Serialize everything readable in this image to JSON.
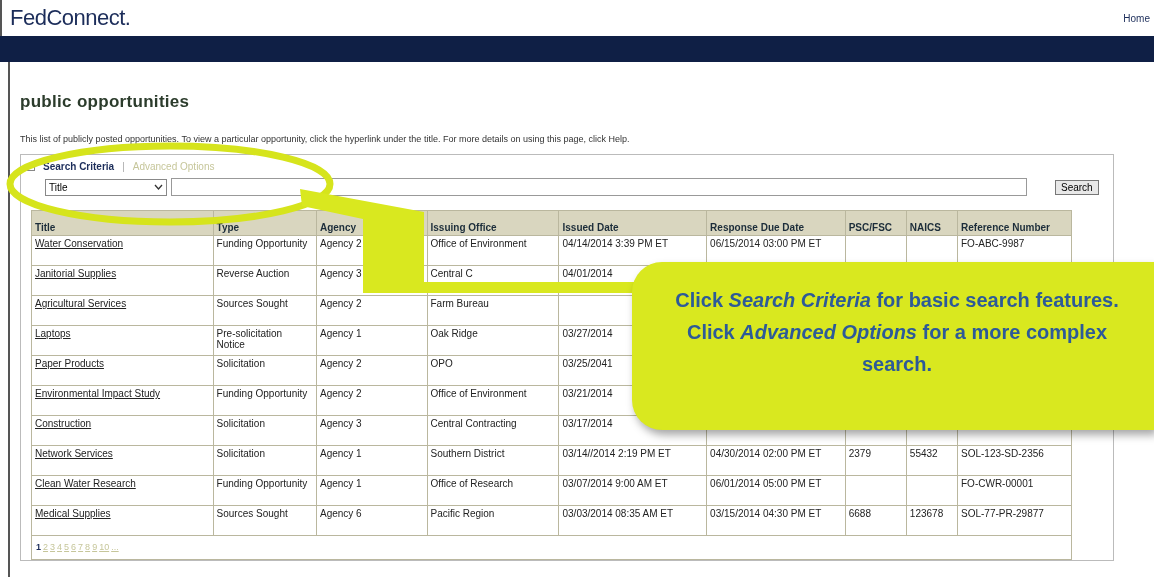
{
  "header": {
    "logo": "FedConnect.",
    "home_link": "Home"
  },
  "page": {
    "title": "public opportunities",
    "intro": "This list of publicly posted opportunities. To view a particular opportunity, click the hyperlink under the title. For more details on using this page, click Help."
  },
  "search": {
    "tabs": [
      {
        "label": "Search Criteria",
        "selected": true
      },
      {
        "label": "Advanced Options",
        "selected": false
      }
    ],
    "separator": "|",
    "field_select": "Title",
    "search_button": "Search"
  },
  "table": {
    "columns": [
      "Title",
      "Type",
      "Agency",
      "Issuing Office",
      "Issued Date",
      "Response Due Date",
      "PSC/FSC",
      "NAICS",
      "Reference Number"
    ],
    "rows": [
      {
        "cells": [
          "Water Conservation",
          "Funding Opportunity",
          "Agency 2",
          "Office of Environment",
          "04/14/2014  3:39  PM  ET",
          "06/15/2014  03:00 PM  ET",
          null,
          null,
          "FO-ABC-9987"
        ]
      },
      {
        "cells": [
          "Janitorial Supplies",
          "Reverse Auction",
          "Agency 3",
          "Central C",
          "04/01/2014",
          null,
          null,
          null,
          null
        ]
      },
      {
        "cells": [
          "Agricultural Services",
          "Sources Sought",
          "Agency 2",
          "Farm Bureau",
          null,
          null,
          null,
          null,
          null
        ]
      },
      {
        "cells": [
          "Laptops",
          "Pre-solicitation Notice",
          "Agency 1",
          "Oak Ridge",
          "03/27/2014",
          null,
          null,
          null,
          null
        ]
      },
      {
        "cells": [
          "Paper Products",
          "Solicitation",
          "Agency 2",
          "OPO",
          "03/25/2041",
          null,
          null,
          null,
          null
        ]
      },
      {
        "cells": [
          "Environmental Impact Study",
          "Funding Opportunity",
          "Agency 2",
          "Office of Environment",
          "03/21/2014",
          null,
          null,
          null,
          null
        ]
      },
      {
        "cells": [
          "Construction",
          "Solicitation",
          "Agency 3",
          "Central Contracting",
          "03/17/2014",
          null,
          null,
          null,
          null
        ]
      },
      {
        "cells": [
          "Network Services",
          "Solicitation",
          "Agency 1",
          "Southern District",
          "03/14//2014  2:19 PM  ET",
          "04/30/2014  02:00 PM ET",
          "2379",
          "55432",
          "SOL-123-SD-2356"
        ]
      },
      {
        "cells": [
          "Clean Water Research",
          "Funding Opportunity",
          "Agency 1",
          "Office of Research",
          "03/07/2014  9:00  AM  ET",
          "06/01/2014 05:00 PM   ET",
          null,
          null,
          "FO-CWR-00001"
        ]
      },
      {
        "cells": [
          "Medical Supplies",
          "Sources Sought",
          "Agency 6",
          "Pacific Region",
          "03/03/2014  08:35  AM  ET",
          "03/15/2014  04:30 PM ET",
          "6688",
          "123678",
          "SOL-77-PR-29877"
        ]
      }
    ],
    "pages": [
      {
        "label": "1",
        "selected": true
      },
      {
        "label": "2",
        "selected": false
      },
      {
        "label": "3",
        "selected": false
      },
      {
        "label": "4",
        "selected": false
      },
      {
        "label": "5",
        "selected": false
      },
      {
        "label": "6",
        "selected": false
      },
      {
        "label": "7",
        "selected": false
      },
      {
        "label": "8",
        "selected": false
      },
      {
        "label": "9",
        "selected": false
      },
      {
        "label": "10",
        "selected": false
      },
      {
        "label": "...",
        "selected": false
      }
    ]
  },
  "callout": {
    "text": "Click *Search Criteria* for basic search features.  Click *Advanced Options* for a more complex search."
  }
}
